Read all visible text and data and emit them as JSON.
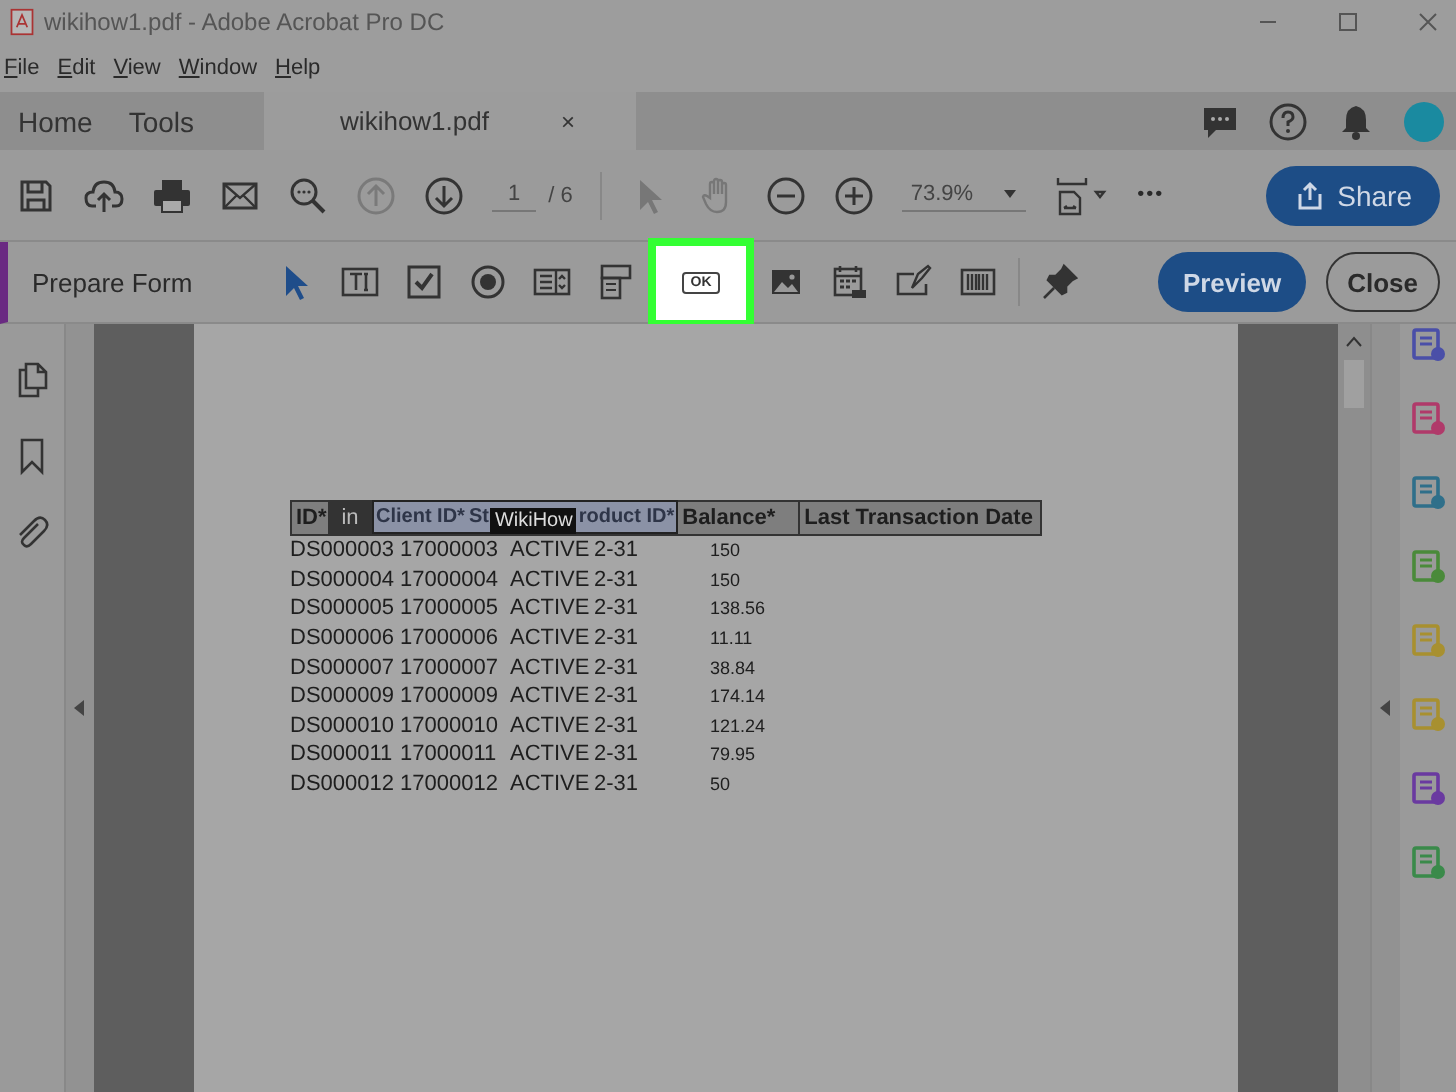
{
  "window": {
    "title": "wikihow1.pdf - Adobe Acrobat Pro DC"
  },
  "menu": [
    "File",
    "Edit",
    "View",
    "Window",
    "Help"
  ],
  "tabs": [
    {
      "label": "Home",
      "selected": false,
      "closable": false
    },
    {
      "label": "Tools",
      "selected": false,
      "closable": false
    },
    {
      "label": "wikihow1.pdf",
      "selected": true,
      "closable": true,
      "close": "×"
    }
  ],
  "toolbar": {
    "page": "1",
    "pages": "/ 6",
    "zoom": "73.9%",
    "more": "•••",
    "share": "Share"
  },
  "prepare_form": {
    "title": "Prepare Form",
    "tools": [
      {
        "kind": "select",
        "selected": false
      },
      {
        "kind": "textfield",
        "selected": false
      },
      {
        "kind": "checkbox",
        "selected": false
      },
      {
        "kind": "radio",
        "selected": false
      },
      {
        "kind": "listbox",
        "selected": false
      },
      {
        "kind": "dropdown",
        "selected": false
      },
      {
        "kind": "button",
        "selected": true,
        "label": "OK"
      },
      {
        "kind": "image",
        "selected": false
      },
      {
        "kind": "date",
        "selected": false
      },
      {
        "kind": "signature",
        "selected": false
      },
      {
        "kind": "barcode",
        "selected": false
      }
    ],
    "preview": "Preview",
    "close": "Close"
  },
  "document": {
    "header": [
      "ID*",
      "in",
      "Client ID*",
      "St",
      "roduct ID*",
      "Balance*",
      "Last Transaction Date"
    ],
    "field_tag": "WikiHow",
    "rows": [
      [
        "DS000003",
        "17000003",
        "ACTIVE",
        "2-31",
        "150"
      ],
      [
        "DS000004",
        "17000004",
        "ACTIVE",
        "2-31",
        "150"
      ],
      [
        "DS000005",
        "17000005",
        "ACTIVE",
        "2-31",
        "138.56"
      ],
      [
        "DS000006",
        "17000006",
        "ACTIVE",
        "2-31",
        "11.11"
      ],
      [
        "DS000007",
        "17000007",
        "ACTIVE",
        "2-31",
        "38.84"
      ],
      [
        "DS000009",
        "17000009",
        "ACTIVE",
        "2-31",
        "174.14"
      ],
      [
        "DS000010",
        "17000010",
        "ACTIVE",
        "2-31",
        "121.24"
      ],
      [
        "DS000011",
        "17000011",
        "ACTIVE",
        "2-31",
        "79.95"
      ],
      [
        "DS000012",
        "17000012",
        "ACTIVE",
        "2-31",
        "50"
      ]
    ]
  },
  "right_tools": [
    {
      "color": "#4a4fa8"
    },
    {
      "color": "#b03a6a"
    },
    {
      "color": "#2f6f8a"
    },
    {
      "color": "#4a8a3a"
    },
    {
      "color": "#a89030"
    },
    {
      "color": "#a89030"
    },
    {
      "color": "#6a3aa0"
    },
    {
      "color": "#3a8a4a"
    }
  ]
}
